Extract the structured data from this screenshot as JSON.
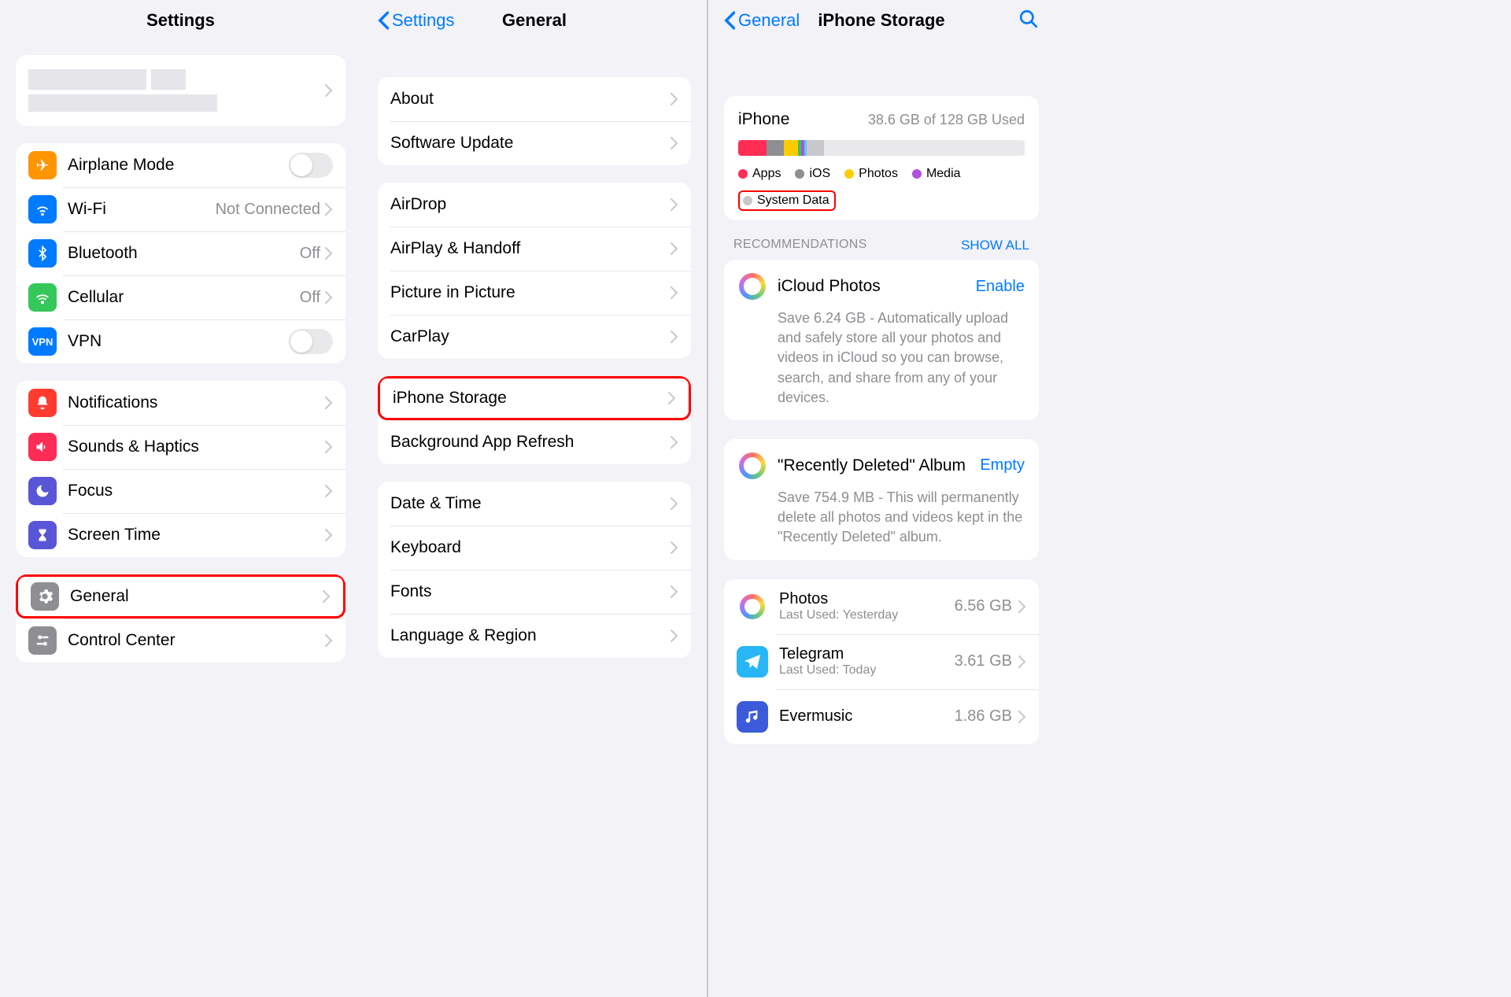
{
  "panel1": {
    "title": "Settings",
    "airplane": "Airplane Mode",
    "wifi": "Wi-Fi",
    "wifi_status": "Not Connected",
    "bluetooth": "Bluetooth",
    "bluetooth_status": "Off",
    "cellular": "Cellular",
    "cellular_status": "Off",
    "vpn": "VPN",
    "notifications": "Notifications",
    "sounds": "Sounds & Haptics",
    "focus": "Focus",
    "screentime": "Screen Time",
    "general": "General",
    "controlcenter": "Control Center"
  },
  "panel2": {
    "back": "Settings",
    "title": "General",
    "about": "About",
    "software_update": "Software Update",
    "airdrop": "AirDrop",
    "airplay": "AirPlay & Handoff",
    "pip": "Picture in Picture",
    "carplay": "CarPlay",
    "storage": "iPhone Storage",
    "refresh": "Background App Refresh",
    "datetime": "Date & Time",
    "keyboard": "Keyboard",
    "fonts": "Fonts",
    "language": "Language & Region"
  },
  "panel3": {
    "back": "General",
    "title": "iPhone Storage",
    "device": "iPhone",
    "usage": "38.6 GB of 128 GB Used",
    "legend": {
      "apps": "Apps",
      "ios": "iOS",
      "photos": "Photos",
      "media": "Media",
      "system": "System Data"
    },
    "recommendations": "RECOMMENDATIONS",
    "show_all": "SHOW ALL",
    "rec1_title": "iCloud Photos",
    "rec1_action": "Enable",
    "rec1_desc": "Save 6.24 GB - Automatically upload and safely store all your photos and videos in iCloud so you can browse, search, and share from any of your devices.",
    "rec2_title": "\"Recently Deleted\" Album",
    "rec2_action": "Empty",
    "rec2_desc": "Save 754.9 MB - This will permanently delete all photos and videos kept in the \"Recently Deleted\" album.",
    "app_photos": "Photos",
    "app_photos_sub": "Last Used: Yesterday",
    "app_photos_size": "6.56 GB",
    "app_telegram": "Telegram",
    "app_telegram_sub": "Last Used: Today",
    "app_telegram_size": "3.61 GB",
    "app_evermusic": "Evermusic",
    "app_evermusic_size": "1.86 GB"
  }
}
